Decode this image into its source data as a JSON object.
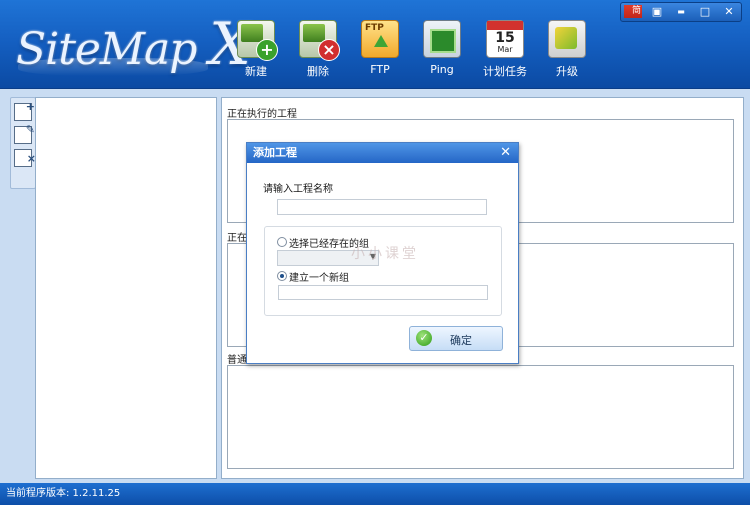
{
  "app": {
    "logo_text": "SiteMap",
    "logo_x": "X"
  },
  "toolbar": {
    "new": "新建",
    "delete": "删除",
    "ftp": "FTP",
    "ping": "Ping",
    "schedule": "计划任务",
    "upgrade": "升级",
    "ftp_icon_text": "FTP",
    "cal_day": "15",
    "cal_month": "Mar"
  },
  "window": {
    "lang_badge": "简",
    "restore": "▣",
    "minimize": "▬",
    "maximize": "□",
    "close": "✕"
  },
  "sections": {
    "running": "正在执行的工程",
    "waiting": "正在",
    "normal": "普通"
  },
  "dialog": {
    "title": "添加工程",
    "close": "✕",
    "prompt": "请输入工程名称",
    "name_value": "",
    "opt_existing": "选择已经存在的组",
    "opt_new": "建立一个新组",
    "group_value": "",
    "ok": "确定",
    "watermark": "小小课堂"
  },
  "status": {
    "text": "当前程序版本: 1.2.11.25"
  },
  "colors": {
    "header": "#1560c2",
    "accent": "#2566c6"
  }
}
